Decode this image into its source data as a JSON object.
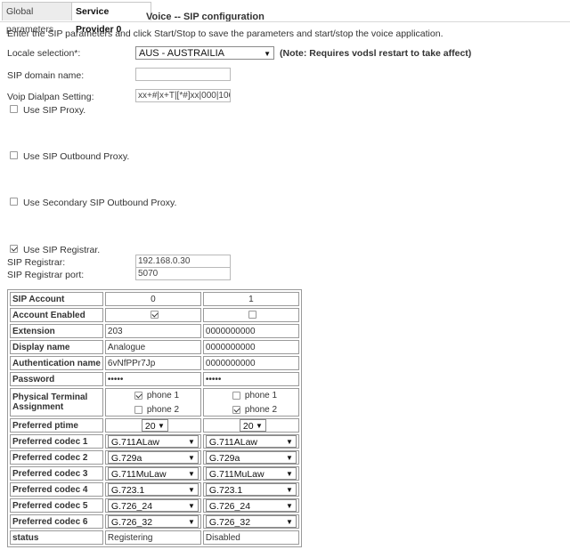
{
  "tabs": {
    "global": "Global parameters",
    "provider": "Service Provider 0"
  },
  "page_title": "Voice -- SIP configuration",
  "intro": "Enter the SIP parameters and click Start/Stop to save the parameters and start/stop the voice application.",
  "locale": {
    "label": "Locale selection*:",
    "value": "AUS - AUSTRAILIA",
    "note": "(Note: Requires vodsl restart to take affect)"
  },
  "sip_domain": {
    "label": "SIP domain name:",
    "value": ""
  },
  "dialplan": {
    "label": "Voip Dialpan Setting:",
    "value": "xx+#|x+T|[*#]xx|000|106"
  },
  "use_sip_proxy": {
    "label": "Use SIP Proxy.",
    "checked": false
  },
  "use_outbound_proxy": {
    "label": "Use SIP Outbound Proxy.",
    "checked": false
  },
  "use_secondary_outbound": {
    "label": "Use Secondary SIP Outbound Proxy.",
    "checked": false
  },
  "use_registrar": {
    "label": "Use SIP Registrar.",
    "checked": true
  },
  "registrar": {
    "label": "SIP Registrar:",
    "value": "192.168.0.30"
  },
  "registrar_port": {
    "label": "SIP Registrar port:",
    "value": "5070"
  },
  "table": {
    "rows": {
      "account": "SIP Account",
      "enabled": "Account Enabled",
      "extension": "Extension",
      "display_name": "Display name",
      "auth_name": "Authentication name",
      "password": "Password",
      "terminal": "Physical Terminal Assignment",
      "ptime": "Preferred ptime",
      "codec1": "Preferred codec 1",
      "codec2": "Preferred codec 2",
      "codec3": "Preferred codec 3",
      "codec4": "Preferred codec 4",
      "codec5": "Preferred codec 5",
      "codec6": "Preferred codec 6",
      "status": "status"
    },
    "phone1": "phone 1",
    "phone2": "phone 2",
    "accounts": [
      {
        "id": "0",
        "enabled": true,
        "extension": "203",
        "display_name": "Analogue",
        "auth_name": "6vNfPPr7Jp",
        "password": "•••••",
        "phone1": true,
        "phone2": false,
        "ptime": "20",
        "codec1": "G.711ALaw",
        "codec2": "G.729a",
        "codec3": "G.711MuLaw",
        "codec4": "G.723.1",
        "codec5": "G.726_24",
        "codec6": "G.726_32",
        "status": "Registering"
      },
      {
        "id": "1",
        "enabled": false,
        "extension": "0000000000",
        "display_name": "0000000000",
        "auth_name": "0000000000",
        "password": "•••••",
        "phone1": false,
        "phone2": true,
        "ptime": "20",
        "codec1": "G.711ALaw",
        "codec2": "G.729a",
        "codec3": "G.711MuLaw",
        "codec4": "G.723.1",
        "codec5": "G.726_24",
        "codec6": "G.726_32",
        "status": "Disabled"
      }
    ]
  }
}
